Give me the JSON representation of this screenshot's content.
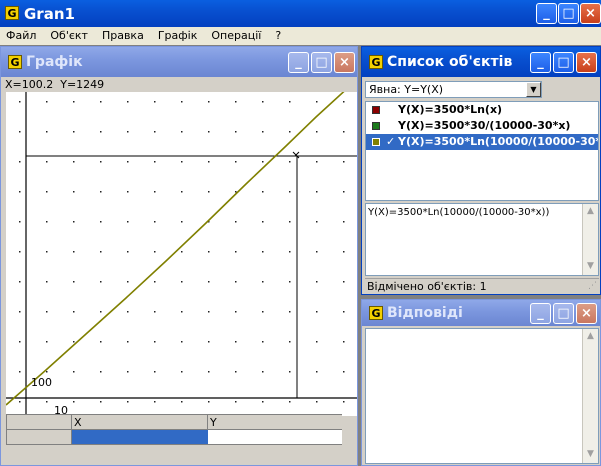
{
  "app": {
    "title": "Gran1",
    "icon_letter": "G"
  },
  "menu": [
    "Файл",
    "Об'єкт",
    "Правка",
    "Графік",
    "Операції",
    "?"
  ],
  "graph_window": {
    "title": "Графік",
    "coords": "X=100.2  Y=1249",
    "y_tick": "100",
    "x_tick": "10"
  },
  "table": {
    "col_x": "X",
    "col_y": "Y"
  },
  "objects_window": {
    "title": "Список об'єктів",
    "type_select": "Явна: Y=Y(X)",
    "items": [
      {
        "label": "Y(X)=3500*Ln(x)",
        "color": "#8b0000",
        "selected": false
      },
      {
        "label": "Y(X)=3500*30/(10000-30*x)",
        "color": "#1c7a1c",
        "selected": false
      },
      {
        "label": "Y(X)=3500*Ln(10000/(10000-30*",
        "color": "#808000",
        "selected": true
      }
    ],
    "checkmark": "✓",
    "formula": "Y(X)=3500*Ln(10000/(10000-30*x))",
    "status": "Відмічено об'єктів: 1"
  },
  "answers_window": {
    "title": "Відповіді"
  }
}
